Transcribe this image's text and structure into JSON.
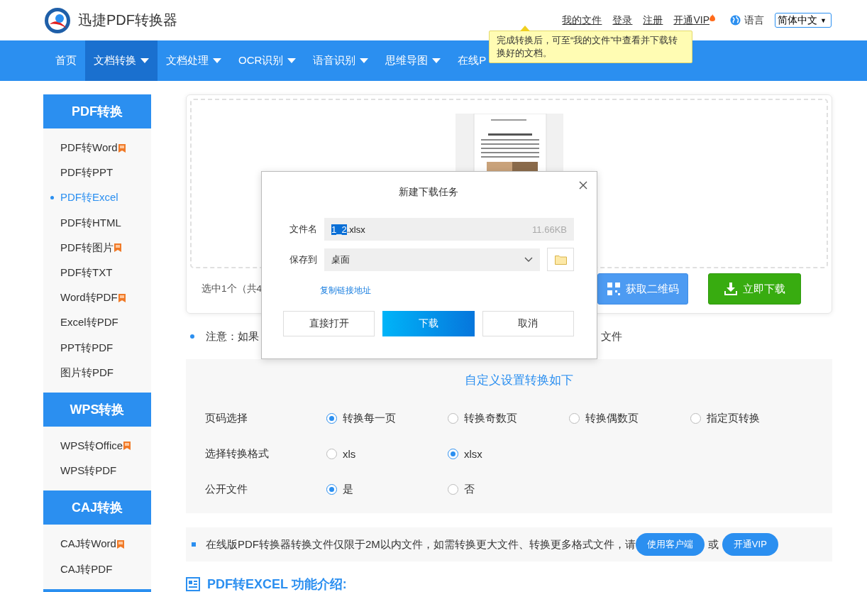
{
  "header": {
    "logo_text": "迅捷PDF转换器",
    "links": [
      {
        "label": "我的文件",
        "kind": "underlined"
      },
      {
        "label": "登录",
        "kind": "underlined"
      },
      {
        "label": "注册",
        "kind": "underlined"
      },
      {
        "label": "开通VIP",
        "kind": "vip"
      }
    ],
    "language": {
      "label": "语言",
      "value": "简体中文",
      "caret": "▼"
    }
  },
  "tooltip": {
    "text": "完成转换后，可至“我的文件”中查看并下载转换好的文档。"
  },
  "nav": [
    {
      "label": "首页",
      "selected": false,
      "has_menu": false
    },
    {
      "label": "文档转换",
      "selected": true,
      "has_menu": true
    },
    {
      "label": "文档处理",
      "selected": false,
      "has_menu": true
    },
    {
      "label": "OCR识别",
      "selected": false,
      "has_menu": true
    },
    {
      "label": "语音识别",
      "selected": false,
      "has_menu": true
    },
    {
      "label": "思维导图",
      "selected": false,
      "has_menu": true
    },
    {
      "label": "在线P",
      "selected": false,
      "has_menu": false
    }
  ],
  "sidebar": [
    {
      "title": "PDF转换",
      "items": [
        {
          "label": "PDF转Word",
          "selected": false,
          "badge": true
        },
        {
          "label": "PDF转PPT",
          "selected": false,
          "badge": false
        },
        {
          "label": "PDF转Excel",
          "selected": true,
          "badge": false
        },
        {
          "label": "PDF转HTML",
          "selected": false,
          "badge": false
        },
        {
          "label": "PDF转图片",
          "selected": false,
          "badge": true
        },
        {
          "label": "PDF转TXT",
          "selected": false,
          "badge": false
        },
        {
          "label": "Word转PDF",
          "selected": false,
          "badge": true
        },
        {
          "label": "Excel转PDF",
          "selected": false,
          "badge": false
        },
        {
          "label": "PPT转PDF",
          "selected": false,
          "badge": false
        },
        {
          "label": "图片转PDF",
          "selected": false,
          "badge": false
        }
      ]
    },
    {
      "title": "WPS转换",
      "items": [
        {
          "label": "WPS转Office",
          "selected": false,
          "badge": true
        },
        {
          "label": "WPS转PDF",
          "selected": false,
          "badge": false
        }
      ]
    },
    {
      "title": "CAJ转换",
      "items": [
        {
          "label": "CAJ转Word",
          "selected": false,
          "badge": true
        },
        {
          "label": "CAJ转PDF",
          "selected": false,
          "badge": false
        }
      ]
    }
  ],
  "upload": {
    "status": "选中1个（共4",
    "qr_button": "获取二维码",
    "download_button": "立即下载"
  },
  "dialog": {
    "title": "新建下载任务",
    "filename_label": "文件名",
    "filename_selected": "1_2",
    "filename_rest": ".xlsx",
    "size": "11.66KB",
    "save_label": "保存到",
    "save_value": "桌面",
    "copy_link": "复制链接地址",
    "buttons": [
      {
        "label": "直接打开",
        "primary": false
      },
      {
        "label": "下载",
        "primary": true
      },
      {
        "label": "取消",
        "primary": false
      }
    ]
  },
  "note": {
    "left": "注意：如果",
    "right": "文件"
  },
  "settings": {
    "title": "自定义设置转换如下",
    "rows": [
      {
        "label": "页码选择",
        "options": [
          {
            "label": "转换每一页",
            "selected": true
          },
          {
            "label": "转换奇数页",
            "selected": false
          },
          {
            "label": "转换偶数页",
            "selected": false
          },
          {
            "label": "指定页转换",
            "selected": false
          }
        ]
      },
      {
        "label": "选择转换格式",
        "options": [
          {
            "label": "xls",
            "selected": false
          },
          {
            "label": "xlsx",
            "selected": true
          }
        ]
      },
      {
        "label": "公开文件",
        "options": [
          {
            "label": "是",
            "selected": true
          },
          {
            "label": "否",
            "selected": false
          }
        ]
      }
    ]
  },
  "notice": {
    "text": "在线版PDF转换器转换文件仅限于2M以内文件，如需转换更大文件、转换更多格式文件，请",
    "buttons": [
      "使用客户端",
      "开通VIP"
    ],
    "joiner": "或"
  },
  "intro_heading": "PDF转EXCEL 功能介绍:"
}
